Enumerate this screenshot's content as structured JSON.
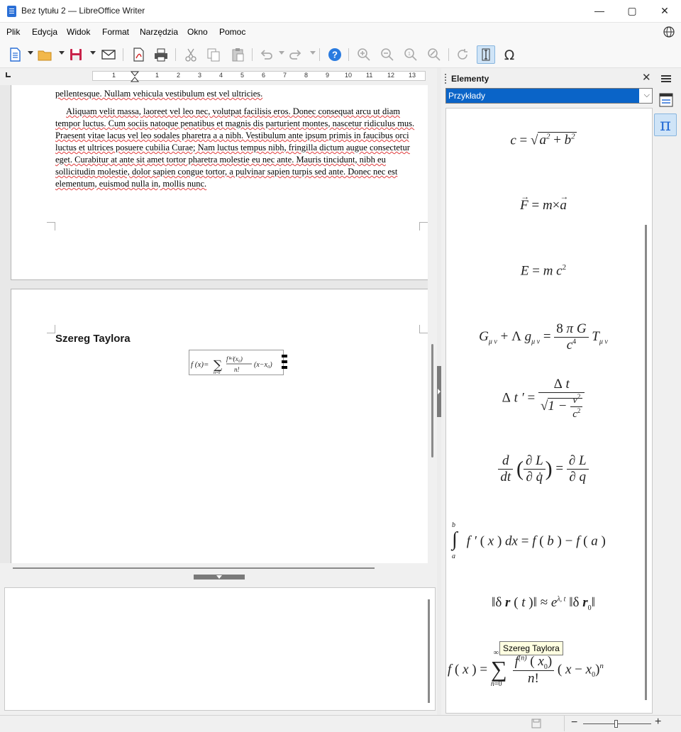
{
  "window": {
    "title": "Bez tytułu 2 — LibreOffice Writer"
  },
  "menu": [
    "Plik",
    "Edycja",
    "Widok",
    "Format",
    "Narzędzia",
    "Okno",
    "Pomoc"
  ],
  "ruler": {
    "numbers": [
      "1",
      "1",
      "2",
      "3",
      "4",
      "5",
      "6",
      "7",
      "8",
      "9",
      "10",
      "11",
      "12",
      "13"
    ]
  },
  "document": {
    "paragraph1_tail": "pellentesque. Nullam vehicula vestibulum est vel ultricies.",
    "paragraph2": "Aliquam velit massa, laoreet vel leo nec, volutpat facilisis eros. Donec consequat arcu ut diam tempor luctus. Cum sociis natoque penatibus et magnis dis parturient montes, nascetur ridiculus mus. Praesent vitae lacus vel leo sodales pharetra a a nibh. Vestibulum ante ipsum primis in faucibus orci luctus et ultrices posuere cubilia Curae; Nam luctus tempus nibh, fringilla dictum augue consectetur eget. Curabitur at ante sit amet tortor pharetra molestie eu nec ante. Mauris tincidunt, nibh eu sollicitudin molestie, dolor sapien congue tortor, a pulvinar sapien turpis sed ante. Donec nec est elementum, euismod nulla in, mollis nunc.",
    "heading": "Szereg Taylora",
    "formula_object": "f(x)=Σ f⁽ⁿ⁾(x₀)/n! (x−x₀)ⁿ"
  },
  "sidebar": {
    "title": "Elementy",
    "category_selected": "Przykłady",
    "tooltip": "Szereg Taylora"
  },
  "colors": {
    "accent": "#0a64c8",
    "brand": "#2a6fd6",
    "spell_underline": "#e03c3c"
  }
}
